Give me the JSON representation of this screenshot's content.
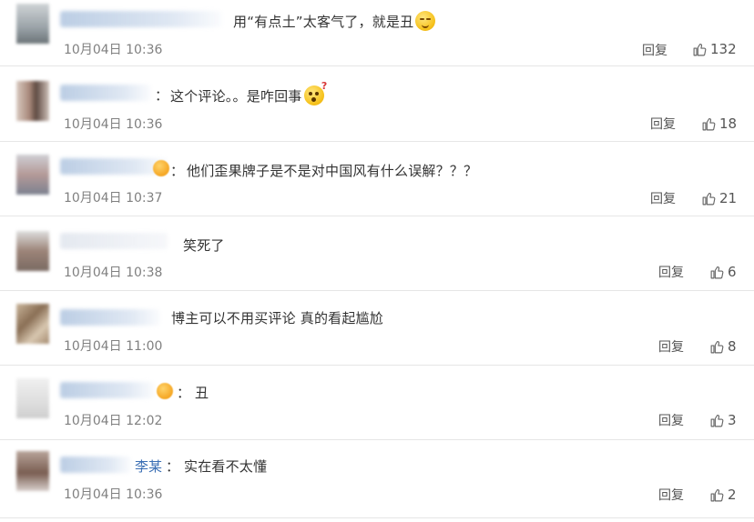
{
  "comments": [
    {
      "name": "",
      "text": "用“有点土”太客气了，就是丑",
      "emoji": "relieved-face-emoji",
      "time": "10月04日 10:36",
      "reply": "回复",
      "likes": "132"
    },
    {
      "name": "",
      "colon": "：",
      "text": "这个评论。。是咋回事",
      "emoji": "confused-face-emoji",
      "time": "10月04日 10:36",
      "reply": "回复",
      "likes": "18"
    },
    {
      "name": "",
      "colon": "：",
      "text": "他们歪果牌子是不是对中国风有什么误解？？？",
      "time": "10月04日 10:37",
      "reply": "回复",
      "likes": "21"
    },
    {
      "name": "",
      "text": "笑死了",
      "time": "10月04日 10:38",
      "reply": "回复",
      "likes": "6"
    },
    {
      "name": "",
      "text": "博主可以不用买评论 真的看起尴尬",
      "time": "10月04日 11:00",
      "reply": "回复",
      "likes": "8"
    },
    {
      "name": "",
      "colon": "：",
      "text": "丑",
      "time": "10月04日 12:02",
      "reply": "回复",
      "likes": "3"
    },
    {
      "name": "李某",
      "colon": "：",
      "text": "实在看不太懂",
      "time": "10月04日 10:36",
      "reply": "回复",
      "likes": "2"
    }
  ],
  "colors": {
    "link": "#3b6fb5",
    "text": "#333333",
    "meta": "#808080",
    "divider": "#e6e6e6"
  },
  "icons": {
    "like": "thumbs-up-icon"
  }
}
